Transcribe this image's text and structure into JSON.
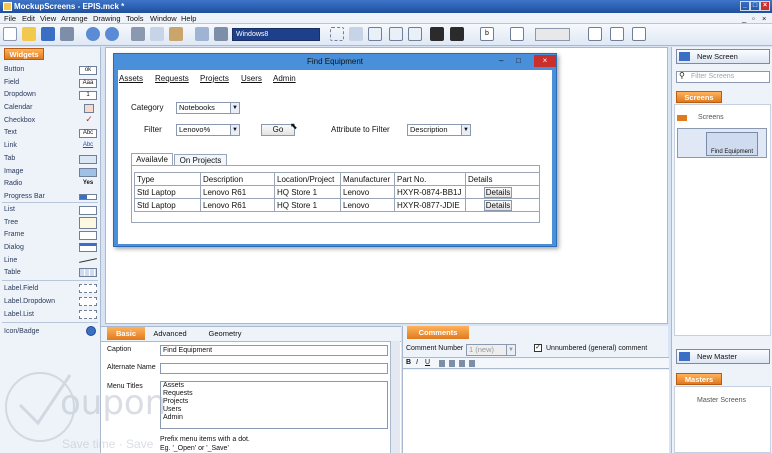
{
  "window": {
    "title": "MockupScreens - EPIS.mck *"
  },
  "menu": [
    "File",
    "Edit",
    "View",
    "Arrange",
    "Drawing",
    "Tools",
    "Window",
    "Help"
  ],
  "toolbar": {
    "theme_select": "Windows8"
  },
  "widgets_panel": {
    "tab": "Widgets",
    "items": [
      "Button",
      "Field",
      "Dropdown",
      "Calendar",
      "Checkbox",
      "Text",
      "Link",
      "Tab",
      "Image",
      "Radio",
      "Progress Bar",
      "List",
      "Tree",
      "Frame",
      "Dialog",
      "Line",
      "Table",
      "Label.Field",
      "Label.Dropdown",
      "Label.List",
      "Icon/Badge"
    ],
    "icon_texts": {
      "button": "ok",
      "field": "Aaa",
      "dropdown": "1",
      "text": "Abc",
      "link": "Abc",
      "radio": "Yes"
    }
  },
  "dialog": {
    "title": "Find Equipment",
    "menus": [
      "Assets",
      "Requests",
      "Projects",
      "Users",
      "Admin"
    ],
    "category_label": "Category",
    "category_value": "Notebooks",
    "filter_label": "Filter",
    "filter_value": "Lenovo%",
    "go_button": "Go",
    "attribute_label": "Attribute to Filter",
    "attribute_value": "Description",
    "tabs": [
      "Availavle",
      "On Projects"
    ],
    "columns": [
      "Type",
      "Description",
      "Location/Project",
      "Manufacturer",
      "Part No.",
      "Details"
    ],
    "rows": [
      [
        "Std Laptop",
        "Lenovo R61",
        "HQ Store 1",
        "Lenovo",
        "HXYR-0874-BB1J",
        "Details"
      ],
      [
        "Std Laptop",
        "Lenovo R61",
        "HQ Store 1",
        "Lenovo",
        "HXYR-0877-JDIE",
        "Details"
      ]
    ]
  },
  "properties": {
    "tabs": [
      "Basic",
      "Advanced",
      "Geometry"
    ],
    "caption_label": "Caption",
    "caption_value": "Find Equipment",
    "alt_name_label": "Alternate Name",
    "alt_name_value": "",
    "menu_titles_label": "Menu Titles",
    "menu_titles": [
      "Assets",
      "Requests",
      "Projects",
      "Users",
      "Admin"
    ],
    "hint_line1": "Prefix menu items with a dot.",
    "hint_line2": "Eg. '_Open' or '_Save'"
  },
  "comments": {
    "tab": "Comments",
    "number_label": "Comment Number",
    "number_value": "1 (new)",
    "unnumbered_label": "Unnumbered (general) comment",
    "format_buttons": [
      "B",
      "I",
      "U"
    ]
  },
  "right_panel": {
    "new_screen": "New Screen",
    "filter_placeholder": "Filter Screens",
    "screens_tab": "Screens",
    "screens_root": "Screens",
    "thumb_label": "Find Equipment",
    "new_master": "New Master",
    "masters_tab": "Masters",
    "master_screens": "Master Screens"
  },
  "watermark": {
    "brand": "oupon",
    "tagline": "Save time · Save"
  }
}
